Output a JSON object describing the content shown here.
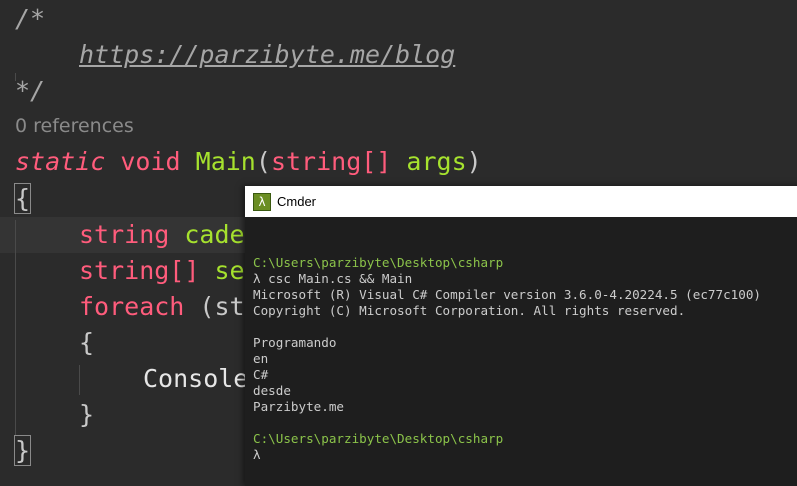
{
  "editor": {
    "comment_open": "/*",
    "comment_url": "https://parzibyte.me/blog",
    "comment_close": "*/",
    "references": "0 references",
    "line_main": {
      "static": "static",
      "void": "void",
      "name": "Main",
      "paren_open": "(",
      "type": "string[]",
      "arg": "args",
      "paren_close": ")"
    },
    "brace_open": "{",
    "line_cadena": {
      "type": "string",
      "rest": "cade"
    },
    "line_array": {
      "type": "string[]",
      "rest": "se"
    },
    "line_foreach": {
      "kw": "foreach",
      "rest": "(st"
    },
    "inner_brace_open": "{",
    "line_console": "Console",
    "inner_brace_close": "}",
    "brace_close": "}"
  },
  "cmder": {
    "title": "Cmder",
    "icon": "lambda-icon",
    "lines": [
      {
        "text": "",
        "cls": ""
      },
      {
        "text": "C:\\Users\\parzibyte\\Desktop\\csharp",
        "cls": "path"
      },
      {
        "text": "λ csc Main.cs && Main",
        "cls": ""
      },
      {
        "text": "Microsoft (R) Visual C# Compiler version 3.6.0-4.20224.5 (ec77c100)",
        "cls": ""
      },
      {
        "text": "Copyright (C) Microsoft Corporation. All rights reserved.",
        "cls": ""
      },
      {
        "text": "",
        "cls": ""
      },
      {
        "text": "Programando",
        "cls": ""
      },
      {
        "text": "en",
        "cls": ""
      },
      {
        "text": "C#",
        "cls": ""
      },
      {
        "text": "desde",
        "cls": ""
      },
      {
        "text": "Parzibyte.me",
        "cls": ""
      },
      {
        "text": "",
        "cls": ""
      },
      {
        "text": "C:\\Users\\parzibyte\\Desktop\\csharp",
        "cls": "path"
      },
      {
        "text": "λ",
        "cls": ""
      }
    ]
  }
}
